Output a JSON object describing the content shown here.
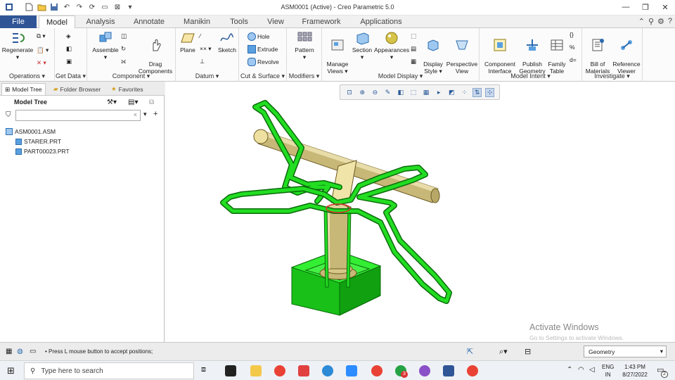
{
  "window": {
    "title": "ASM0001 (Active) - Creo Parametric 5.0"
  },
  "tabs": [
    {
      "label": "File"
    },
    {
      "label": "Model"
    },
    {
      "label": "Analysis"
    },
    {
      "label": "Annotate"
    },
    {
      "label": "Manikin"
    },
    {
      "label": "Tools"
    },
    {
      "label": "View"
    },
    {
      "label": "Framework"
    },
    {
      "label": "Applications"
    }
  ],
  "ribbon": {
    "regenerate": "Regenerate",
    "assemble": "Assemble",
    "drag_components": "Drag\nComponents",
    "plane": "Plane",
    "sketch": "Sketch",
    "hole": "Hole",
    "extrude": "Extrude",
    "revolve": "Revolve",
    "pattern": "Pattern",
    "manage_views": "Manage\nViews",
    "section": "Section",
    "appearances": "Appearances",
    "display_style": "Display\nStyle",
    "perspective_view": "Perspective\nView",
    "component_interface": "Component\nInterface",
    "publish_geometry": "Publish\nGeometry",
    "family_table": "Family\nTable",
    "bill_of_materials": "Bill of\nMaterials",
    "reference_viewer": "Reference\nViewer",
    "groups": {
      "operations": "Operations",
      "get_data": "Get Data",
      "component": "Component",
      "datum": "Datum",
      "cut_surface": "Cut & Surface",
      "modifiers": "Modifiers",
      "model_display": "Model Display",
      "model_intent": "Model Intent",
      "investigate": "Investigate"
    }
  },
  "left_panel": {
    "tabs": {
      "model_tree": "Model Tree",
      "folder_browser": "Folder Browser",
      "favorites": "Favorites"
    },
    "header": "Model Tree",
    "items": [
      {
        "label": "ASM0001.ASM"
      },
      {
        "label": "STARER.PRT"
      },
      {
        "label": "PART00023.PRT"
      }
    ]
  },
  "canvas": {
    "watermark_title": "Activate Windows",
    "watermark_sub": "Go to Settings to activate Windows."
  },
  "status": {
    "message": "Press L mouse button to accept positions;",
    "filter": "Geometry"
  },
  "taskbar": {
    "search_placeholder": "Type here to search",
    "lang": "ENG",
    "region": "IN",
    "time": "1:43 PM",
    "date": "8/27/2022",
    "chrome_badge": "3",
    "notif_count": "2"
  },
  "colors": {
    "file_tab": "#2f5597",
    "model_green": "#22dd22",
    "model_tan": "#c8b878"
  }
}
